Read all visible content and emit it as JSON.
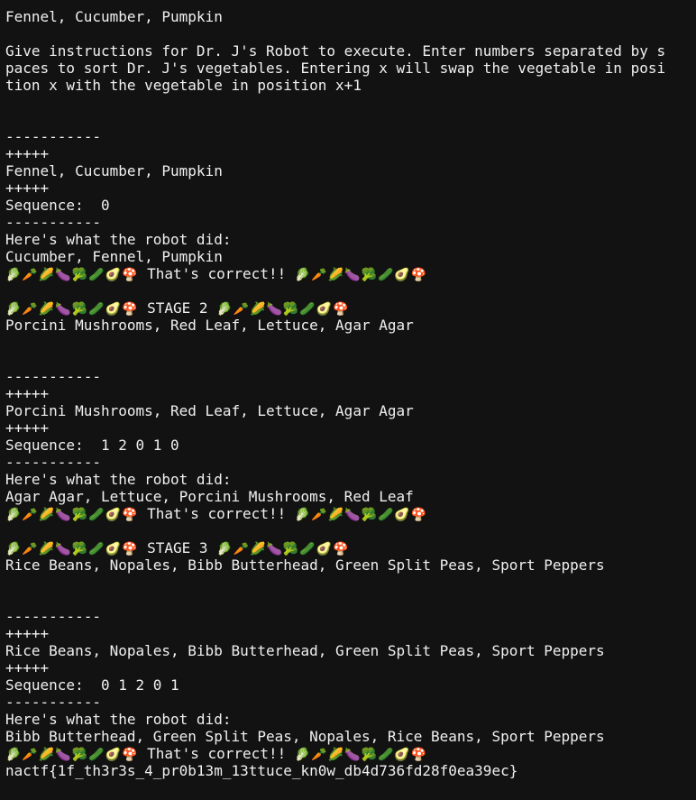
{
  "terminal": {
    "lines": [
      {
        "text": "Fennel, Cucumber, Pumpkin"
      },
      {
        "text": ""
      },
      {
        "text": "Give instructions for Dr. J's Robot to execute. Enter numbers separated by s"
      },
      {
        "text": "paces to sort Dr. J's vegetables. Entering x will swap the vegetable in posi"
      },
      {
        "text": "tion x with the vegetable in position x+1"
      },
      {
        "text": ""
      },
      {
        "text": ""
      },
      {
        "text": "-----------"
      },
      {
        "text": "+++++"
      },
      {
        "text": "Fennel, Cucumber, Pumpkin"
      },
      {
        "text": "+++++"
      },
      {
        "text": "Sequence:  0"
      },
      {
        "text": "-----------"
      },
      {
        "text": "Here's what the robot did:"
      },
      {
        "text": "Cucumber, Fennel, Pumpkin"
      },
      {
        "pre": "🥬🥕🌽🍆🥦🥒🥑🍄",
        "text": " That's correct!! ",
        "post": "🥬🥕🌽🍆🥦🥒🥑🍄"
      },
      {
        "text": ""
      },
      {
        "pre": "🥬🥕🌽🍆🥦🥒🥑🍄",
        "text": " STAGE 2 ",
        "post": "🥬🥕🌽🍆🥦🥒🥑🍄"
      },
      {
        "text": "Porcini Mushrooms, Red Leaf, Lettuce, Agar Agar"
      },
      {
        "text": ""
      },
      {
        "text": ""
      },
      {
        "text": "-----------"
      },
      {
        "text": "+++++"
      },
      {
        "text": "Porcini Mushrooms, Red Leaf, Lettuce, Agar Agar"
      },
      {
        "text": "+++++"
      },
      {
        "text": "Sequence:  1 2 0 1 0"
      },
      {
        "text": "-----------"
      },
      {
        "text": "Here's what the robot did:"
      },
      {
        "text": "Agar Agar, Lettuce, Porcini Mushrooms, Red Leaf"
      },
      {
        "pre": "🥬🥕🌽🍆🥦🥒🥑🍄",
        "text": " That's correct!! ",
        "post": "🥬🥕🌽🍆🥦🥒🥑🍄"
      },
      {
        "text": ""
      },
      {
        "pre": "🥬🥕🌽🍆🥦🥒🥑🍄",
        "text": " STAGE 3 ",
        "post": "🥬🥕🌽🍆🥦🥒🥑🍄"
      },
      {
        "text": "Rice Beans, Nopales, Bibb Butterhead, Green Split Peas, Sport Peppers"
      },
      {
        "text": ""
      },
      {
        "text": ""
      },
      {
        "text": "-----------"
      },
      {
        "text": "+++++"
      },
      {
        "text": "Rice Beans, Nopales, Bibb Butterhead, Green Split Peas, Sport Peppers"
      },
      {
        "text": "+++++"
      },
      {
        "text": "Sequence:  0 1 2 0 1"
      },
      {
        "text": "-----------"
      },
      {
        "text": "Here's what the robot did:"
      },
      {
        "text": "Bibb Butterhead, Green Split Peas, Nopales, Rice Beans, Sport Peppers"
      },
      {
        "pre": "🥬🥕🌽🍆🥦🥒🥑🍄",
        "text": " That's correct!! ",
        "post": "🥬🥕🌽🍆🥦🥒🥑🍄"
      },
      {
        "text": "nactf{1f_th3r3s_4_pr0b13m_13ttuce_kn0w_db4d736fd28f0ea39ec}"
      }
    ]
  }
}
